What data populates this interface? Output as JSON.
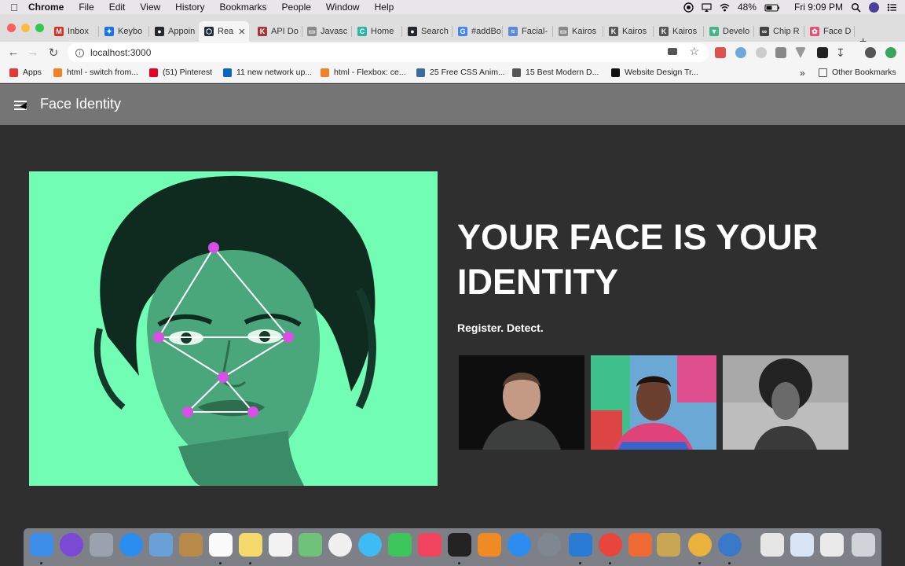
{
  "menubar": {
    "app": "Chrome",
    "items": [
      "File",
      "Edit",
      "View",
      "History",
      "Bookmarks",
      "People",
      "Window",
      "Help"
    ],
    "battery": "48%",
    "clock": "Fri 9:09 PM"
  },
  "tabs": [
    {
      "label": "Inbox",
      "color": "#d93025",
      "glyph": "M"
    },
    {
      "label": "Keybo",
      "color": "#1a73e8",
      "glyph": "✦"
    },
    {
      "label": "Appoin",
      "color": "#24292e",
      "glyph": "●"
    },
    {
      "label": "Rea",
      "color": "#1f2d3d",
      "glyph": "⬡"
    },
    {
      "label": "API Do",
      "color": "#a03a3a",
      "glyph": "K"
    },
    {
      "label": "Javasc",
      "color": "#8a8a8a",
      "glyph": "▭"
    },
    {
      "label": "Home",
      "color": "#2bb5a5",
      "glyph": "C"
    },
    {
      "label": "Search",
      "color": "#24292e",
      "glyph": "●"
    },
    {
      "label": "#addBo",
      "color": "#4285f4",
      "glyph": "G"
    },
    {
      "label": "Facial-",
      "color": "#5c8bd6",
      "glyph": "≈"
    },
    {
      "label": "Kairos",
      "color": "#8a8a8a",
      "glyph": "▭"
    },
    {
      "label": "Kairos",
      "color": "#555555",
      "glyph": "K"
    },
    {
      "label": "Kairos",
      "color": "#555555",
      "glyph": "K"
    },
    {
      "label": "Develo",
      "color": "#41b883",
      "glyph": "▼"
    },
    {
      "label": "Chip R",
      "color": "#444444",
      "glyph": "∞"
    },
    {
      "label": "Face D",
      "color": "#e94e77",
      "glyph": "✿"
    }
  ],
  "active_tab_index": 3,
  "address": {
    "url": "localhost:3000"
  },
  "bookmarks": [
    {
      "label": "Apps",
      "color": "#e53935"
    },
    {
      "label": "html - switch from...",
      "color": "#f48024"
    },
    {
      "label": "(51) Pinterest",
      "color": "#e60023"
    },
    {
      "label": "11 new network up...",
      "color": "#0a66c2"
    },
    {
      "label": "html - Flexbox: ce...",
      "color": "#f48024"
    },
    {
      "label": "25 Free CSS Anim...",
      "color": "#3b6aa0"
    },
    {
      "label": "15 Best Modern D...",
      "color": "#555555"
    },
    {
      "label": "Website Design Tr...",
      "color": "#111111"
    }
  ],
  "bookmarks_overflow": "»",
  "other_bookmarks": "Other Bookmarks",
  "app": {
    "title": "Face Identity",
    "headline": "YOUR FACE IS YOUR IDENTITY",
    "tagline": "Register. Detect.",
    "hero_bg": "#72fdb4",
    "landmark_color": "#d94ee6"
  }
}
